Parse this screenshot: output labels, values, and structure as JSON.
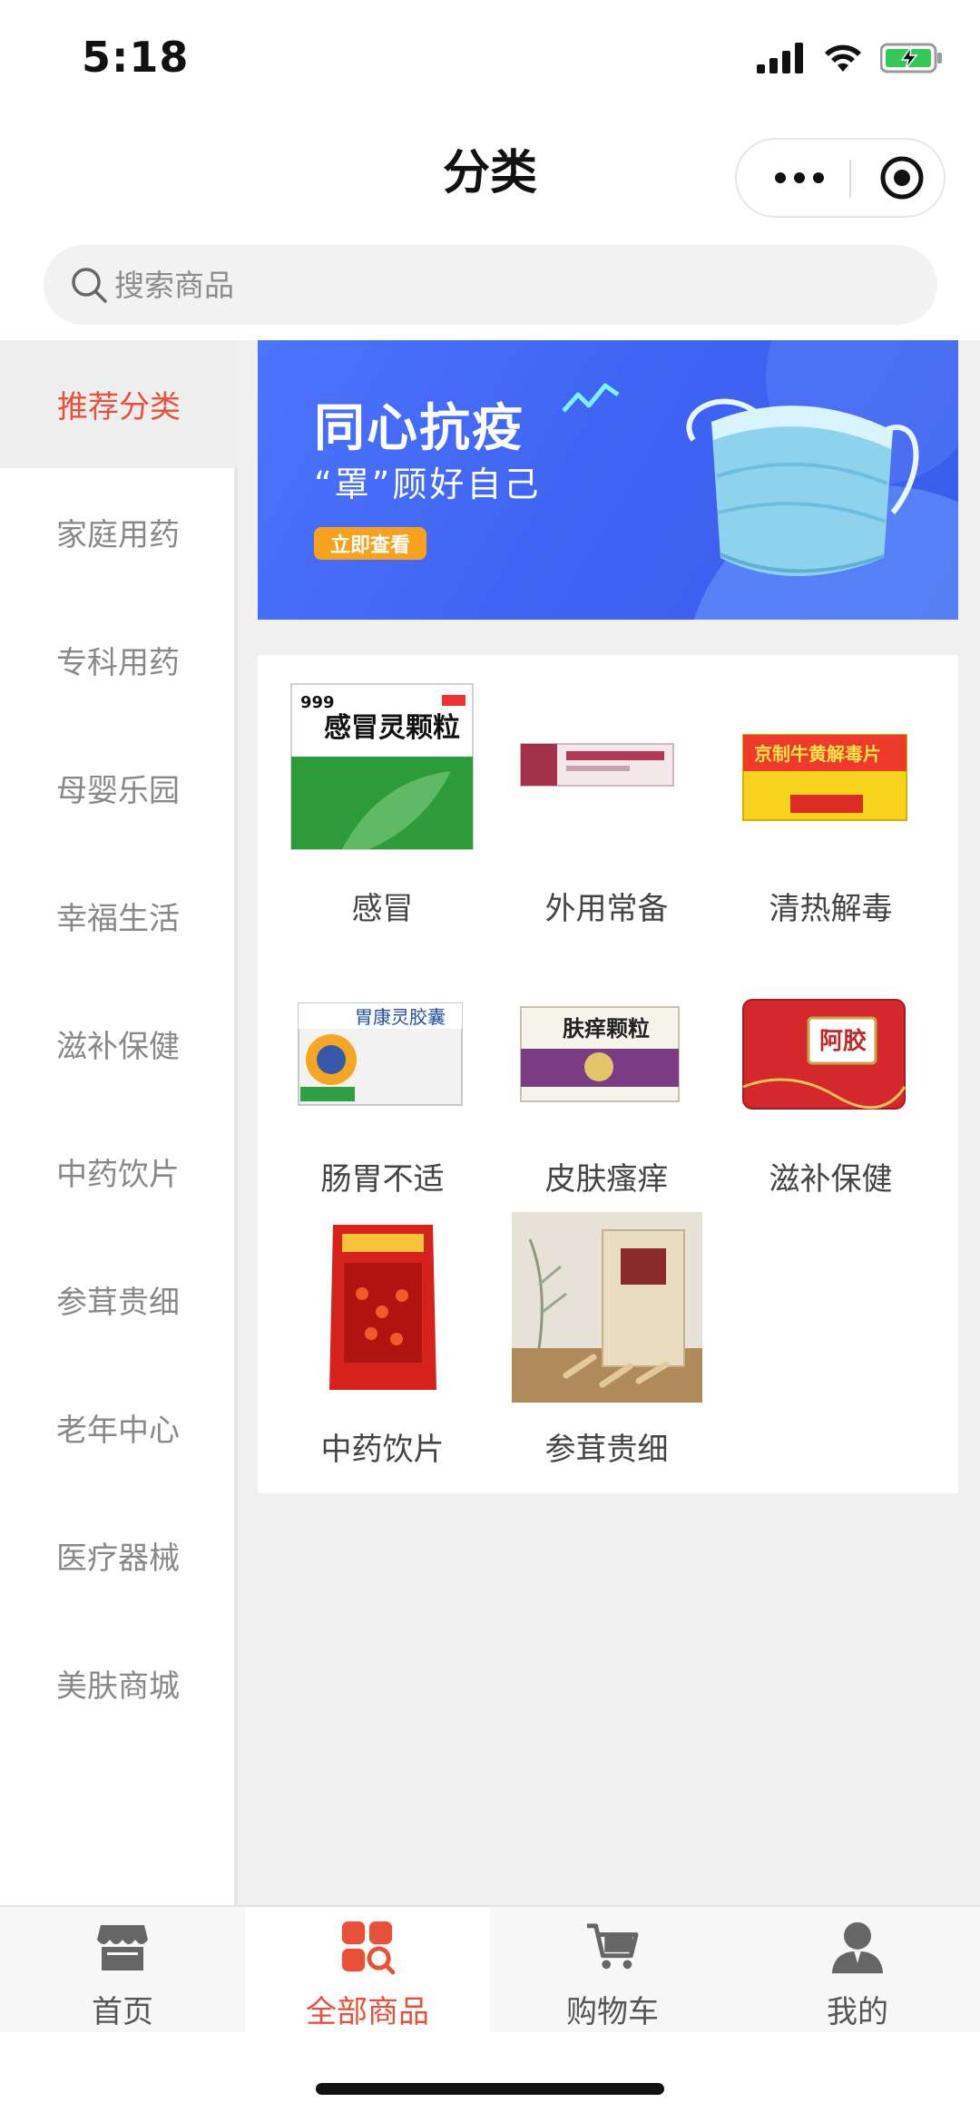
{
  "status_bar": {
    "time": "5:18"
  },
  "nav": {
    "title": "分类"
  },
  "search": {
    "placeholder": "搜索商品"
  },
  "sidebar": {
    "items": [
      {
        "label": "推荐分类",
        "active": true
      },
      {
        "label": "家庭用药"
      },
      {
        "label": "专科用药"
      },
      {
        "label": "母婴乐园"
      },
      {
        "label": "幸福生活"
      },
      {
        "label": "滋补保健"
      },
      {
        "label": "中药饮片"
      },
      {
        "label": "参茸贵细"
      },
      {
        "label": "老年中心"
      },
      {
        "label": "医疗器械"
      },
      {
        "label": "美肤商城"
      }
    ]
  },
  "banner": {
    "title": "同心抗疫",
    "subtitle": "“罩”顾好自己",
    "button": "立即查看"
  },
  "categories": [
    {
      "label": "感冒",
      "box_text": "感冒灵颗粒",
      "brand": "999"
    },
    {
      "label": "外用常备"
    },
    {
      "label": "清热解毒",
      "box_text": "京制牛黄解毒片"
    },
    {
      "label": "肠胃不适",
      "box_text": "胃康灵胶囊"
    },
    {
      "label": "皮肤瘙痒",
      "box_text": "肤痒颗粒"
    },
    {
      "label": "滋补保健",
      "box_text": "阿胶"
    },
    {
      "label": "中药饮片"
    },
    {
      "label": "参茸贵细"
    }
  ],
  "tab_bar": {
    "tabs": [
      {
        "label": "首页",
        "icon": "store-icon"
      },
      {
        "label": "全部商品",
        "icon": "category-search-icon",
        "active": true
      },
      {
        "label": "购物车",
        "icon": "cart-icon"
      },
      {
        "label": "我的",
        "icon": "user-icon"
      }
    ]
  },
  "colors": {
    "accent": "#e8503a",
    "banner_blue": "#4b74ff"
  }
}
